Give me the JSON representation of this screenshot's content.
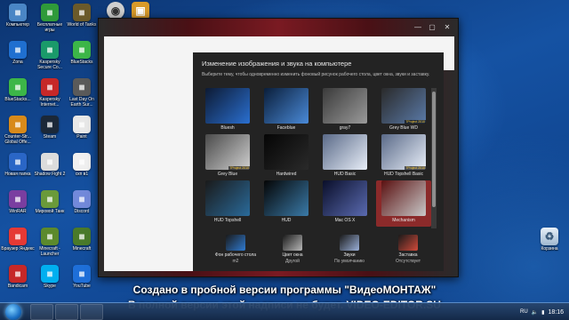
{
  "desktop": {
    "icons": [
      {
        "label": "Компьютер",
        "icon": "computer-icon",
        "color": "#4a86c5"
      },
      {
        "label": "Бесплатные игры",
        "icon": "games-icon",
        "color": "#2f9a3a"
      },
      {
        "label": "World of Tanks",
        "icon": "tank-icon",
        "color": "#6b5a2a"
      },
      {
        "label": "Zona",
        "icon": "zona-icon",
        "color": "#1f6fd0"
      },
      {
        "label": "Kaspersky Secure Co...",
        "icon": "kaspersky-icon",
        "color": "#1a9a6a"
      },
      {
        "label": "BlueStacks",
        "icon": "bluestacks-icon",
        "color": "#3cb648"
      },
      {
        "label": "BlueStacks...",
        "icon": "bluestacks-icon",
        "color": "#3cb648"
      },
      {
        "label": "Kaspersky Internet...",
        "icon": "kaspersky-icon",
        "color": "#c62828"
      },
      {
        "label": "Last Day On Earth Sur...",
        "icon": "game-icon",
        "color": "#5a5a5a"
      },
      {
        "label": "Counter-Str... Global Offe...",
        "icon": "csgo-icon",
        "color": "#d88a1a"
      },
      {
        "label": "Steam",
        "icon": "steam-icon",
        "color": "#1b2838"
      },
      {
        "label": "Paint",
        "icon": "paint-icon",
        "color": "#e8e8e8"
      },
      {
        "label": "Новая папка",
        "icon": "help-icon",
        "color": "#2a66c6"
      },
      {
        "label": "Shadow Fight 2",
        "icon": "file-icon",
        "color": "#dcdcdc"
      },
      {
        "label": "скп в1",
        "icon": "document-icon",
        "color": "#f0f0f0"
      },
      {
        "label": "WinRAR",
        "icon": "winrar-icon",
        "color": "#7a3ea0"
      },
      {
        "label": "Мировой Танк",
        "icon": "minecraft-icon",
        "color": "#6a9a3a"
      },
      {
        "label": "Discord",
        "icon": "discord-icon",
        "color": "#7289da"
      },
      {
        "label": "Браузер Яндекс",
        "icon": "yandex-icon",
        "color": "#e53935"
      },
      {
        "label": "Minecraft - Launcher",
        "icon": "minecraft-icon",
        "color": "#5c8a2c"
      },
      {
        "label": "Minecraft",
        "icon": "minecraft-icon",
        "color": "#4a7a2a"
      },
      {
        "label": "Bandicam",
        "icon": "bandicam-icon",
        "color": "#c62828"
      },
      {
        "label": "Skype",
        "icon": "skype-icon",
        "color": "#00aff0"
      },
      {
        "label": "YouTube",
        "icon": "youtube-icon",
        "color": "#1e6fd9"
      }
    ],
    "top_icons": [
      {
        "label": "",
        "icon": "media-player-icon",
        "color": "#cfcfcf"
      },
      {
        "label": "",
        "icon": "program-icon",
        "color": "#d89a2a"
      }
    ],
    "recycle_bin": {
      "label": "Корзина",
      "icon": "recycle-bin-icon"
    }
  },
  "window": {
    "controls": {
      "minimize": "—",
      "maximize": "▢",
      "close": "✕"
    },
    "panel_title": "Изменение изображения и звука на компьютере",
    "panel_desc": "Выберите тему, чтобы одновременно изменить фоновый рисунок рабочего стола, цвет окна, звуки и заставку.",
    "themes": [
      {
        "name": "Bluesh",
        "colors": [
          "#0d1a33",
          "#2a6fd0"
        ],
        "badge": ""
      },
      {
        "name": "Faceblue",
        "colors": [
          "#0a1e3a",
          "#4a8ad8"
        ],
        "badge": ""
      },
      {
        "name": "gray7",
        "colors": [
          "#3a3a3a",
          "#9a9a9a"
        ],
        "badge": ""
      },
      {
        "name": "Grey Blue WD",
        "colors": [
          "#2a2a2a",
          "#5a7aa8"
        ],
        "badge": "7Project 2010"
      },
      {
        "name": "Grey Blue",
        "colors": [
          "#4a4a4a",
          "#cfcfcf"
        ],
        "badge": "7Project 2010"
      },
      {
        "name": "Hardwired",
        "colors": [
          "#050505",
          "#2a2a2a"
        ],
        "badge": ""
      },
      {
        "name": "HUD Basic",
        "colors": [
          "#5a6a88",
          "#e8eef8"
        ],
        "badge": ""
      },
      {
        "name": "HUD Topshell Basic",
        "colors": [
          "#5a6a88",
          "#e8eef8"
        ],
        "badge": "7Project 2010"
      },
      {
        "name": "HUD Topshell",
        "colors": [
          "#1a1a1a",
          "#2a6a9a"
        ],
        "badge": ""
      },
      {
        "name": "HUD",
        "colors": [
          "#050505",
          "#3a7aa8"
        ],
        "badge": ""
      },
      {
        "name": "Mac OS X",
        "colors": [
          "#0a0f2a",
          "#5a6ab0"
        ],
        "badge": ""
      },
      {
        "name": "Mechanism",
        "colors": [
          "#5a1010",
          "#c8c8c8"
        ],
        "badge": "",
        "selected": true
      }
    ],
    "bottom": [
      {
        "line1": "Фон рабочего стола",
        "line2": "m2",
        "icon": "wallpaper-icon",
        "color": "#2f7ad0"
      },
      {
        "line1": "Цвет окна",
        "line2": "Другой",
        "icon": "window-color-icon",
        "color": "#b8b8b8"
      },
      {
        "line1": "Звуки",
        "line2": "По умолчанию",
        "icon": "sounds-icon",
        "color": "#9ab0d8"
      },
      {
        "line1": "Заставка",
        "line2": "Отсутствует",
        "icon": "screensaver-icon",
        "color": "#d04a3a"
      }
    ]
  },
  "watermark": {
    "line1": "Создано в пробной версии программы \"ВидеоМОНТАЖ\"",
    "line2": "В полной версии этой надписи не будет. VIDEO-EDITOR.SU"
  },
  "taskbar": {
    "lang": "RU",
    "time": "18:16"
  }
}
